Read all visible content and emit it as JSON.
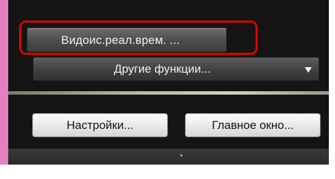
{
  "panel": {
    "live_view_button_label": "Видоис.реал.врем. ...",
    "other_functions_label": "Другие функции...",
    "dropdown_arrow_icon": "triangle-down-icon",
    "settings_button_label": "Настройки...",
    "main_window_button_label": "Главное окно...",
    "bottom_toggle_icon": "dot-icon"
  },
  "colors": {
    "panel_background": "#141414",
    "highlight_border": "#e00000",
    "side_accent": "#e87fc0"
  }
}
